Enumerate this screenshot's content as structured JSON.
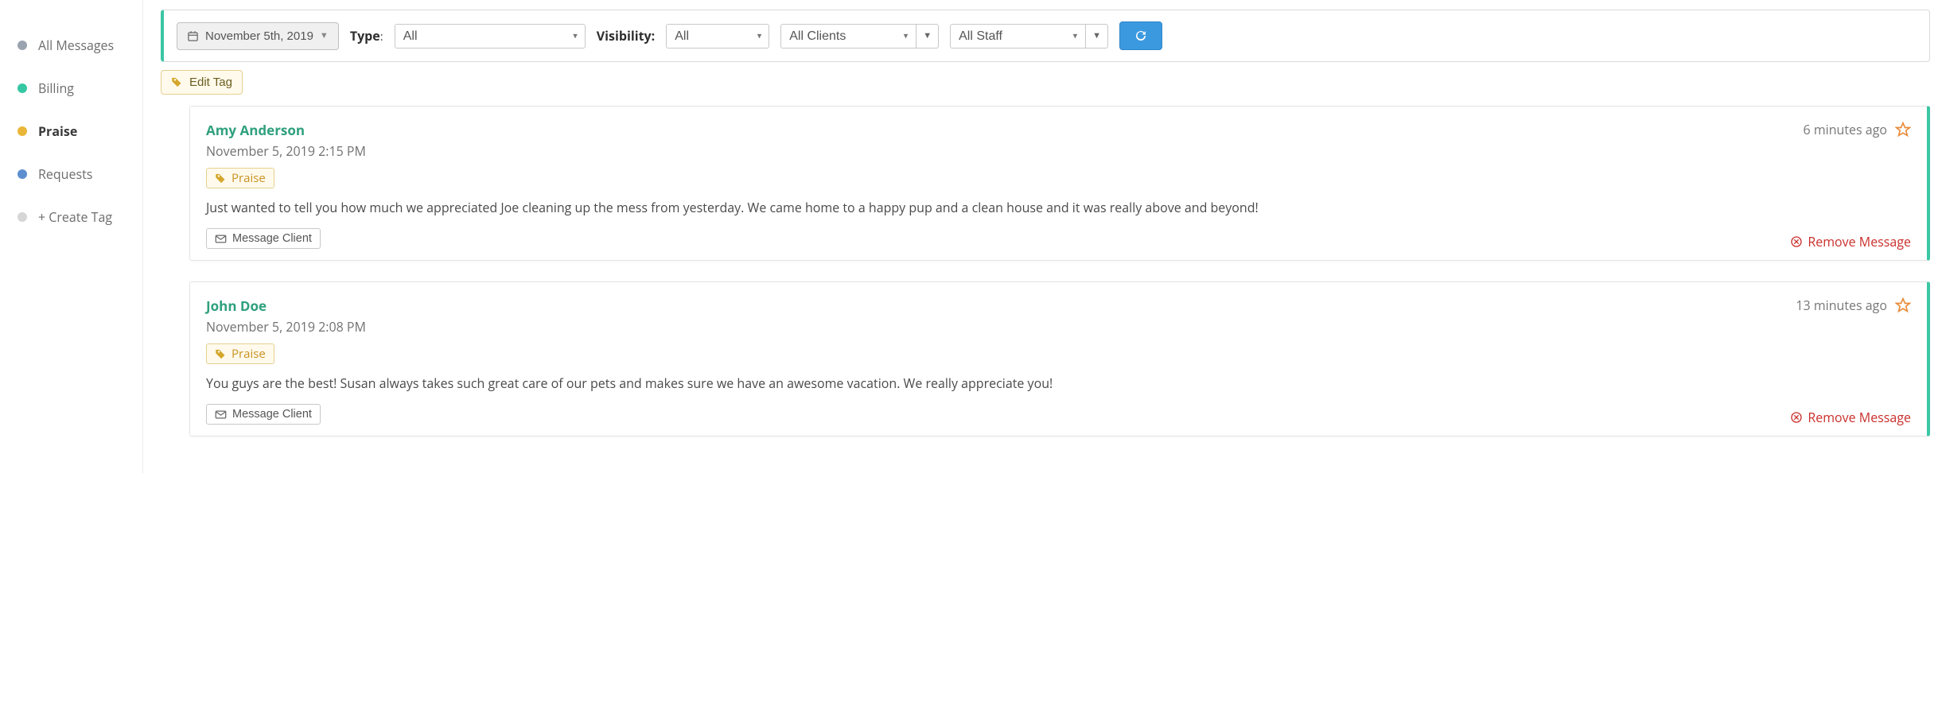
{
  "sidebar": {
    "items": [
      {
        "label": "All Messages",
        "dot": "grey"
      },
      {
        "label": "Billing",
        "dot": "teal"
      },
      {
        "label": "Praise",
        "dot": "gold",
        "active": true
      },
      {
        "label": "Requests",
        "dot": "blue"
      },
      {
        "label": "+ Create Tag",
        "dot": "lightgrey"
      }
    ]
  },
  "filter": {
    "date_label": "November 5th, 2019",
    "type_label": "Type",
    "type_value": "All",
    "visibility_label": "Visibility:",
    "visibility_value": "All",
    "clients_value": "All Clients",
    "staff_value": "All Staff"
  },
  "edit_tag_label": "Edit Tag",
  "messages": [
    {
      "author": "Amy Anderson",
      "relative_time": "6 minutes ago",
      "datetime": "November 5, 2019 2:15 PM",
      "tag": "Praise",
      "body": "Just wanted to tell you how much we appreciated Joe cleaning up the mess from yesterday. We came home to a happy pup and a clean house and it was really above and beyond!",
      "message_client_label": "Message Client",
      "remove_label": "Remove Message"
    },
    {
      "author": "John Doe",
      "relative_time": "13 minutes ago",
      "datetime": "November 5, 2019 2:08 PM",
      "tag": "Praise",
      "body": "You guys are the best! Susan always takes such great care of our pets and makes sure we have an awesome vacation. We really appreciate you!",
      "message_client_label": "Message Client",
      "remove_label": "Remove Message"
    }
  ]
}
